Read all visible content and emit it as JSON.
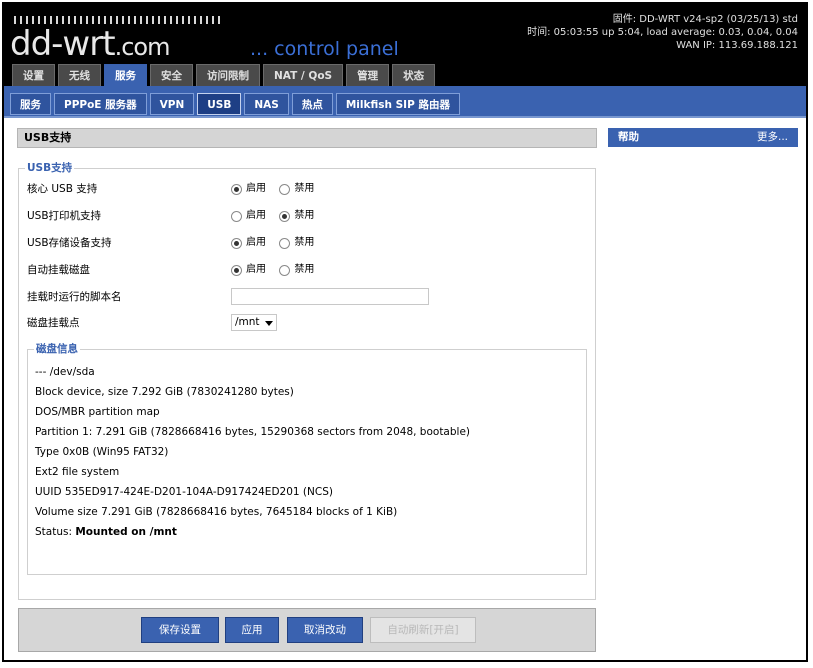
{
  "header": {
    "logo_main": "dd-wrt",
    "logo_suffix": ".com",
    "tagline": "... control panel",
    "firmware": "固件: DD-WRT v24-sp2 (03/25/13) std",
    "uptime": "时间: 05:03:55 up 5:04, load average: 0.03, 0.04, 0.04",
    "wan_ip": "WAN IP: 113.69.188.121"
  },
  "main_tabs": [
    "设置",
    "无线",
    "服务",
    "安全",
    "访问限制",
    "NAT / QoS",
    "管理",
    "状态"
  ],
  "main_tabs_active": "服务",
  "sub_tabs": [
    "服务",
    "PPPoE 服务器",
    "VPN",
    "USB",
    "NAS",
    "热点",
    "Milkfish SIP 路由器"
  ],
  "sub_tabs_active": "USB",
  "section_title": "USB支持",
  "fieldset_legend": "USB支持",
  "radio_labels": {
    "enable": "启用",
    "disable": "禁用"
  },
  "settings": [
    {
      "label": "核心 USB 支持",
      "value": "启用"
    },
    {
      "label": "USB打印机支持",
      "value": "禁用"
    },
    {
      "label": "USB存储设备支持",
      "value": "启用"
    },
    {
      "label": "自动挂载磁盘",
      "value": "启用"
    }
  ],
  "script_label": "挂载时运行的脚本名",
  "script_value": "",
  "mount_label": "磁盘挂载点",
  "mount_value": "/mnt",
  "disk_info": {
    "legend": "磁盘信息",
    "lines": [
      "--- /dev/sda",
      "Block device, size 7.292 GiB (7830241280 bytes)",
      "DOS/MBR partition map",
      "Partition 1: 7.291 GiB (7828668416 bytes, 15290368 sectors from 2048, bootable)",
      "Type 0x0B (Win95 FAT32)",
      "Ext2 file system",
      "UUID 535ED917-424E-D201-104A-D917424ED201 (NCS)",
      "Volume size 7.291 GiB (7828668416 bytes, 7645184 blocks of 1 KiB)"
    ],
    "status_label": "Status:",
    "status_value": "Mounted on /mnt"
  },
  "buttons": {
    "save": "保存设置",
    "apply": "应用",
    "cancel": "取消改动",
    "autorefresh": "自动刷新[开启]"
  },
  "help": {
    "title": "帮助",
    "more": "更多..."
  }
}
